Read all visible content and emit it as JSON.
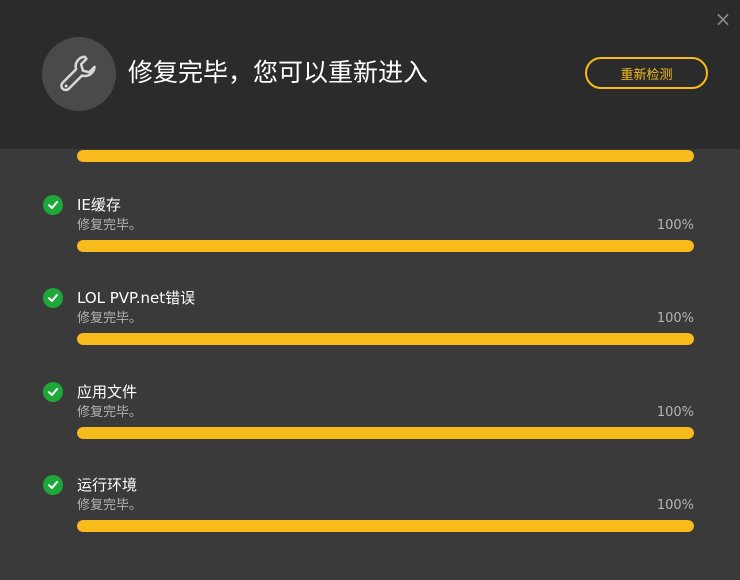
{
  "header": {
    "title": "修复完毕，您可以重新进入",
    "recheck_label": "重新检测",
    "close_label": "×",
    "icon": "wrench-icon"
  },
  "colors": {
    "accent": "#f7bc1c",
    "success": "#1fa83a",
    "header_bg": "#2b2b2b",
    "body_bg": "#3a3a3a"
  },
  "top_progress": {
    "percent": 100
  },
  "items": [
    {
      "title": "IE缓存",
      "status": "修复完毕。",
      "percent_label": "100%",
      "percent": 100
    },
    {
      "title": "LOL PVP.net错误",
      "status": "修复完毕。",
      "percent_label": "100%",
      "percent": 100
    },
    {
      "title": "应用文件",
      "status": "修复完毕。",
      "percent_label": "100%",
      "percent": 100
    },
    {
      "title": "运行环境",
      "status": "修复完毕。",
      "percent_label": "100%",
      "percent": 100
    }
  ]
}
